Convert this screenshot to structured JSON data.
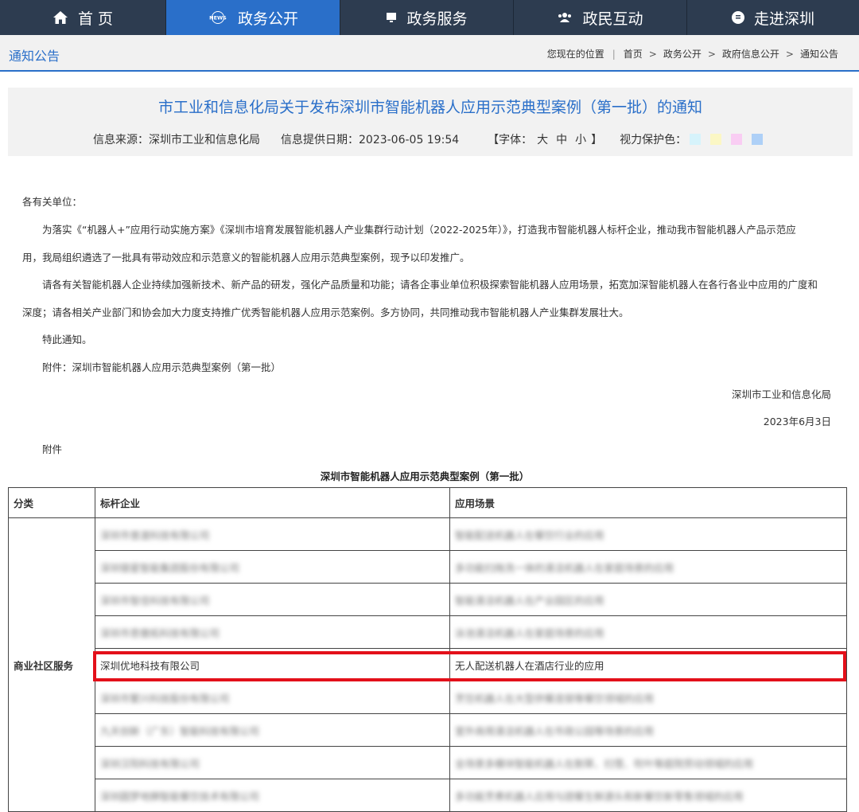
{
  "nav": {
    "items": [
      {
        "label": "首 页",
        "icon": "home-icon"
      },
      {
        "label": "政务公开",
        "icon": "news-icon"
      },
      {
        "label": "政务服务",
        "icon": "monitor-icon"
      },
      {
        "label": "政民互动",
        "icon": "people-icon"
      },
      {
        "label": "走进深圳",
        "icon": "info-icon"
      }
    ],
    "active": "政务公开",
    "news_badge": "NEWS"
  },
  "breadcrumb": {
    "section_title": "通知公告",
    "location_label": "您现在的位置",
    "items": [
      "首页",
      "政务公开",
      "政府信息公开",
      "通知公告"
    ],
    "separator": ">"
  },
  "article": {
    "title": "市工业和信息化局关于发布深圳市智能机器人应用示范典型案例（第一批）的通知",
    "source": "信息来源：深圳市工业和信息化局",
    "date": "信息提供日期：2023-06-05 19:54",
    "font_size_label": "【字体：",
    "font_sizes": [
      "大",
      "中",
      "小"
    ],
    "font_size_close": "】",
    "eye_care_label": "视力保护色：",
    "eye_care_colors": [
      "#d6f3fb",
      "#fbf7c5",
      "#f9cdf3",
      "#aed0f7"
    ],
    "salutation": "各有关单位：",
    "para1_line1": "为落实《“机器人+”应用行动实施方案》《深圳市培育发展智能机器人产业集群行动计划（2022-2025年）》，打造我市智能机器人标杆企业，推动我市智能机器人产品示范应",
    "para1_line2": "用，我局组织遴选了一批具有带动效应和示范意义的智能机器人应用示范典型案例，现予以印发推广。",
    "para2_line1": "请各有关智能机器人企业持续加强新技术、新产品的研发，强化产品质量和功能；请各企事业单位积极探索智能机器人应用场景，拓宽加深智能机器人在各行各业中应用的广度和",
    "para2_line2": "深度；请各相关产业部门和协会加大力度支持推广优秀智能机器人应用示范案例。多方协同，共同推动我市智能机器人产业集群发展壮大。",
    "closing": "特此通知。",
    "attachment_note": "附件：深圳市智能机器人应用示范典型案例（第一批）",
    "signature": "深圳市工业和信息化局",
    "sign_date": "2023年6月3日",
    "attachment_label": "附件"
  },
  "table": {
    "caption": "深圳市智能机器人应用示范典型案例（第一批）",
    "headers": [
      "分类",
      "标杆企业",
      "应用场景"
    ],
    "category": "商业社区服务",
    "rows": [
      {
        "company": "深圳市普渡科技有限公司",
        "scene": "智能配送机器人在餐饮行业的应用",
        "blurred": true
      },
      {
        "company": "深圳银星智能集团股份有限公司",
        "scene": "多功能扫拖洗一体的清洁机器人在家庭场景的应用",
        "blurred": true
      },
      {
        "company": "深圳市智佳科技有限公司",
        "scene": "智能清洁机器人在产业园区的应用",
        "blurred": true
      },
      {
        "company": "深圳市思傲拓科技有限公司",
        "scene": "泳池清洁机器人在家庭场景的应用",
        "blurred": true
      },
      {
        "company": "深圳优地科技有限公司",
        "scene": "无人配送机器人在酒店行业的应用",
        "blurred": false
      },
      {
        "company": "深圳市繁兴科技股份有限公司",
        "scene": "烹饪机器人在大型供餐连锁等餐饮领域的应用",
        "blurred": true
      },
      {
        "company": "九天创新（广东）智能科技有限公司",
        "scene": "室外商用清洁机器人在市政公园等场景的应用",
        "blurred": true
      },
      {
        "company": "深圳汉阳科技有限公司",
        "scene": "全场景多模块智能机器人在割草、扫雪、吹叶等庭院劳动领域的应用",
        "blurred": true
      },
      {
        "company": "深圳圆梦地狮智能餐饮技术有限公司",
        "scene": "多功能烹煮机器人应用与团餐生鲜源头和新餐饮新零售领域的应用",
        "blurred": true
      }
    ]
  },
  "highlight_color": "#e3101a",
  "colors": {
    "nav_bg": "#2d3c50",
    "nav_active": "#2a6fc9",
    "accent": "#2a6fc9"
  }
}
